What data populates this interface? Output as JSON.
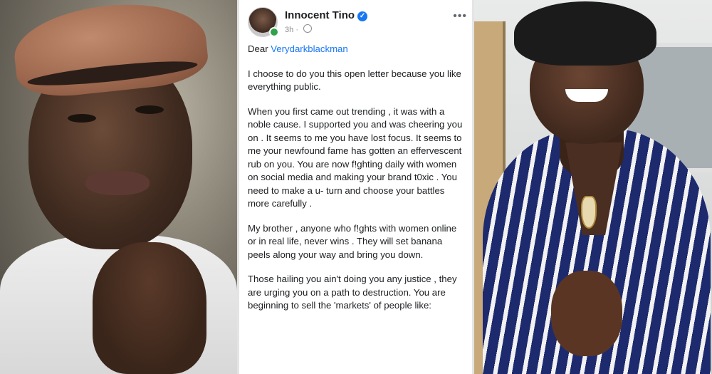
{
  "post": {
    "author": "Innocent Tino",
    "time": "3h",
    "more_icon": "more-dots-icon",
    "greeting_prefix": "Dear ",
    "mention": "Verydarkblackman",
    "paragraphs": [
      "I choose to do you this open letter because you like everything public.",
      "When you first came out trending , it was with a noble cause.  I supported you and was cheering you on . It seems to me you have lost focus. It seems to me your newfound fame has gotten an effervescent rub on you. You are now f!ghting daily with women on social media and making your brand t0xic . You need to make a u- turn and choose your battles more carefully .",
      "My brother , anyone who f!ghts with women online or in real life, never wins . They will set banana peels along your way and bring you down.",
      "Those hailing you ain't doing you any justice , they are urging you on a path to destruction. You are beginning to sell the 'markets' of people like:"
    ]
  },
  "colors": {
    "link": "#1877f2",
    "verified": "#1877f2",
    "online": "#31a24c"
  }
}
